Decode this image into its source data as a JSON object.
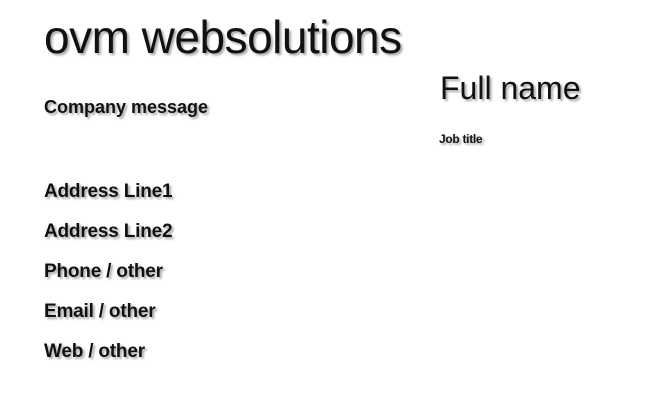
{
  "company": {
    "name": "ovm websolutions",
    "message": "Company message"
  },
  "person": {
    "full_name": "Full name",
    "job_title": "Job title"
  },
  "contact": {
    "address_line1": "Address Line1",
    "address_line2": "Address Line2",
    "phone": "Phone / other",
    "email": "Email / other",
    "web": "Web / other"
  }
}
